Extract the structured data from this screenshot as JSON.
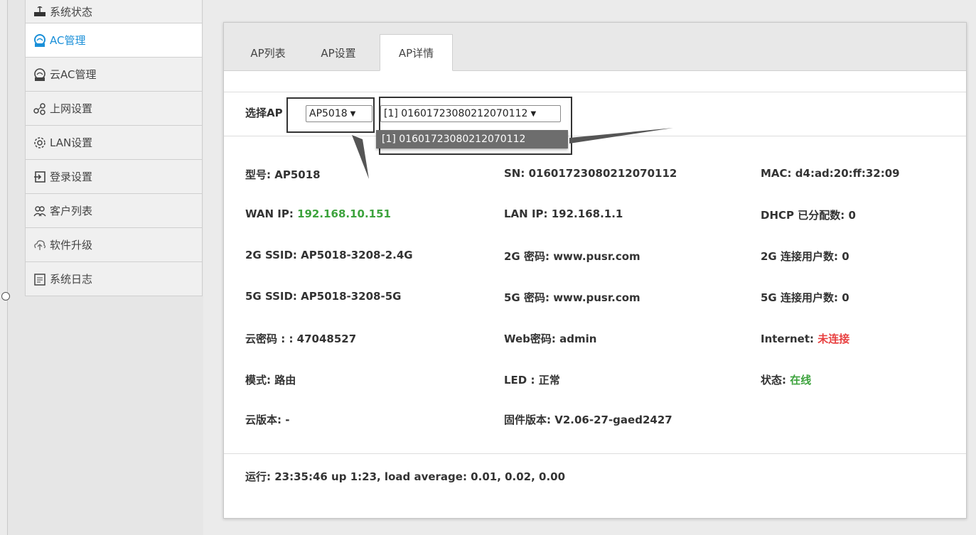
{
  "sidebar": {
    "items": [
      {
        "label": "系统状态",
        "icon": "router-icon"
      },
      {
        "label": "AC管理",
        "icon": "ac-ap-icon"
      },
      {
        "label": "云AC管理",
        "icon": "ac-ap-icon"
      },
      {
        "label": "上网设置",
        "icon": "network-icon"
      },
      {
        "label": "LAN设置",
        "icon": "gear-icon"
      },
      {
        "label": "登录设置",
        "icon": "login-icon"
      },
      {
        "label": "客户列表",
        "icon": "users-icon"
      },
      {
        "label": "软件升级",
        "icon": "upload-icon"
      },
      {
        "label": "系统日志",
        "icon": "log-icon"
      }
    ],
    "active_index": 1
  },
  "tabs": [
    {
      "label": "AP列表"
    },
    {
      "label": "AP设置"
    },
    {
      "label": "AP详情"
    }
  ],
  "select": {
    "label": "选择AP",
    "ap_value": "AP5018",
    "device_value": "[1] 01601723080212070112",
    "dropdown_option": "[1] 01601723080212070112"
  },
  "details": {
    "model": {
      "label": "型号: ",
      "value": "AP5018"
    },
    "sn": {
      "label": "SN: ",
      "value": "01601723080212070112"
    },
    "mac": {
      "label": "MAC: ",
      "value": "d4:ad:20:ff:32:09"
    },
    "wan_ip": {
      "label": "WAN IP: ",
      "value": "192.168.10.151"
    },
    "lan_ip": {
      "label": "LAN IP: ",
      "value": "192.168.1.1"
    },
    "dhcp": {
      "label": "DHCP 已分配数: ",
      "value": "0"
    },
    "ssid_2g": {
      "label": "2G SSID: ",
      "value": "AP5018-3208-2.4G"
    },
    "pwd_2g": {
      "label": "2G 密码: ",
      "value": "www.pusr.com"
    },
    "users_2g": {
      "label": "2G 连接用户数: ",
      "value": "0"
    },
    "ssid_5g": {
      "label": "5G SSID: ",
      "value": "AP5018-3208-5G"
    },
    "pwd_5g": {
      "label": "5G 密码: ",
      "value": "www.pusr.com"
    },
    "users_5g": {
      "label": "5G 连接用户数: ",
      "value": "0"
    },
    "cloud_pwd": {
      "label": "云密码 : : ",
      "value": "47048527"
    },
    "web_pwd": {
      "label": "Web密码: ",
      "value": "admin"
    },
    "internet": {
      "label": "Internet: ",
      "value": "未连接"
    },
    "mode": {
      "label": "模式: ",
      "value": "路由"
    },
    "led": {
      "label": "LED : ",
      "value": "正常"
    },
    "status": {
      "label": "状态: ",
      "value": "在线"
    },
    "cloud_ver": {
      "label": "云版本: ",
      "value": "-"
    },
    "firmware": {
      "label": "固件版本: ",
      "value": "V2.06-27-gaed2427"
    }
  },
  "runtime": "运行: 23:35:46 up 1:23, load average: 0.01, 0.02, 0.00",
  "colors": {
    "accent": "#1a8fd8",
    "ok": "#3da33d",
    "error": "#e84040"
  }
}
